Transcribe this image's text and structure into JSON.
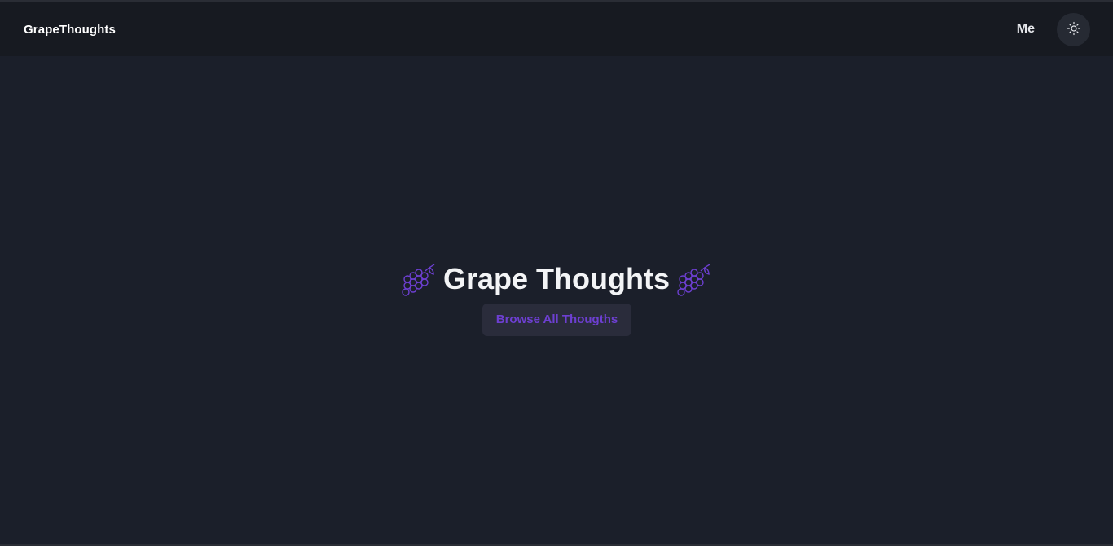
{
  "navbar": {
    "brand": "GrapeThoughts",
    "links": [
      {
        "label": "Me"
      }
    ],
    "theme_toggle_icon": "sun-icon"
  },
  "hero": {
    "title": "Grape Thoughts",
    "title_icon": "grapes-icon",
    "browse_button_label": "Browse All Thougths"
  },
  "colors": {
    "background": "#1b1f2a",
    "navbar": "#171a21",
    "accent": "#6d3fd1",
    "text": "#f3f4f6"
  }
}
